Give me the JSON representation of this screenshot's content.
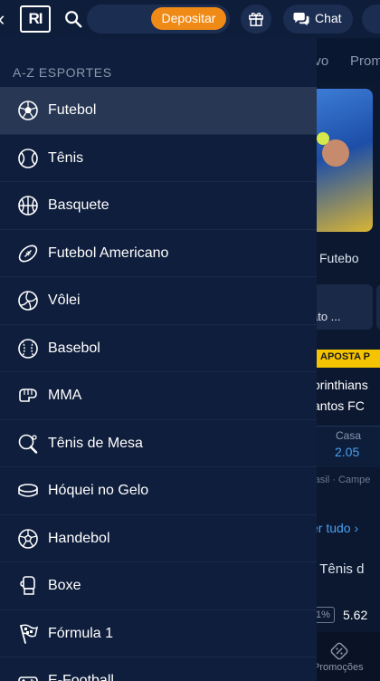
{
  "topbar": {
    "logo": "RI",
    "deposit_label": "Depositar",
    "chat_label": "Chat"
  },
  "drawer": {
    "title": "A-Z ESPORTES",
    "sports": [
      {
        "label": "Futebol",
        "icon": "soccer-ball-icon",
        "active": true
      },
      {
        "label": "Tênis",
        "icon": "tennis-ball-icon",
        "active": false
      },
      {
        "label": "Basquete",
        "icon": "basketball-icon",
        "active": false
      },
      {
        "label": "Futebol Americano",
        "icon": "american-football-icon",
        "active": false
      },
      {
        "label": "Vôlei",
        "icon": "volleyball-icon",
        "active": false
      },
      {
        "label": "Basebol",
        "icon": "baseball-icon",
        "active": false
      },
      {
        "label": "MMA",
        "icon": "mma-glove-icon",
        "active": false
      },
      {
        "label": "Tênis de Mesa",
        "icon": "table-tennis-paddle-icon",
        "active": false
      },
      {
        "label": "Hóquei no Gelo",
        "icon": "hockey-puck-icon",
        "active": false
      },
      {
        "label": "Handebol",
        "icon": "handball-icon",
        "active": false
      },
      {
        "label": "Boxe",
        "icon": "boxing-glove-icon",
        "active": false
      },
      {
        "label": "Fórmula 1",
        "icon": "racing-flag-icon",
        "active": false
      },
      {
        "label": "E-Football",
        "icon": "esports-controller-icon",
        "active": false
      }
    ]
  },
  "background": {
    "tab1": "ivo",
    "tab2": "Prom",
    "chip": "Futebo",
    "card_text": "ato ...",
    "promo": "APOSTA P",
    "team1": "orinthians",
    "team2": "antos FC",
    "odd_label": "Casa",
    "odd_value": "2.05",
    "league": "rasil · Campe",
    "see_all": "er tudo",
    "tab3": "l    Tênis d",
    "pct": "1%",
    "odd2": "5.62",
    "nav_label": "Promoções"
  },
  "colors": {
    "accent_orange": "#f08a17",
    "drawer_bg": "#0f1e3c",
    "active_row": "#273754",
    "link_blue": "#4aa0f0",
    "promo_yellow": "#f5c400"
  }
}
